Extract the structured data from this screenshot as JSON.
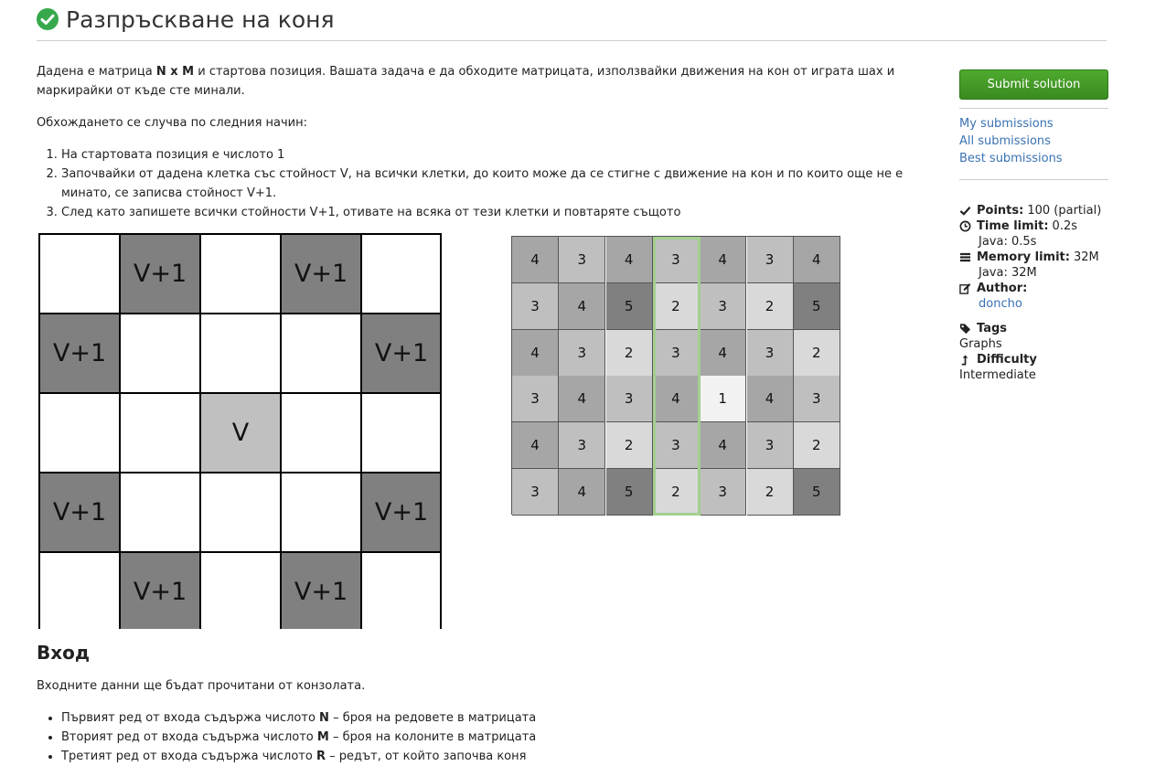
{
  "header": {
    "title": "Разпръскване на коня"
  },
  "statement": {
    "intro_1": "Дадена е матрица ",
    "intro_bold": "N x M",
    "intro_2": " и стартова позиция. Вашата задача е да обходите матрицата, използвайки движения на кон от играта шах и маркирайки от къде сте минали.",
    "process_intro": "Обхождането се случва по следния начин:",
    "steps": [
      "На стартовата позиция е числото 1",
      "Започвайки от дадена клетка със стойност V, на всички клетки, до които може да се стигне с движение на кон и по които още не е минато, се записва стойност V+1.",
      "След като запишете всички стойности V+1, отивате на всяка от тези клетки и повтаряте същото"
    ]
  },
  "illustration_left": {
    "rows": [
      [
        "",
        "V+1",
        "",
        "V+1",
        ""
      ],
      [
        "V+1",
        "",
        "",
        "",
        "V+1"
      ],
      [
        "",
        "",
        "V",
        "",
        ""
      ],
      [
        "V+1",
        "",
        "",
        "",
        "V+1"
      ],
      [
        "",
        "V+1",
        "",
        "V+1",
        ""
      ]
    ],
    "colors": {
      "target": "#808080",
      "source": "#c0c0c0",
      "empty": "#ffffff"
    }
  },
  "illustration_right": {
    "rows": [
      [
        "4",
        "3",
        "4",
        "3",
        "4",
        "3",
        "4"
      ],
      [
        "3",
        "4",
        "5",
        "2",
        "3",
        "2",
        "5"
      ],
      [
        "4",
        "3",
        "2",
        "3",
        "4",
        "3",
        "2"
      ],
      [
        "3",
        "4",
        "3",
        "4",
        "1",
        "4",
        "3"
      ],
      [
        "4",
        "3",
        "2",
        "3",
        "4",
        "3",
        "2"
      ],
      [
        "3",
        "4",
        "5",
        "2",
        "3",
        "2",
        "5"
      ]
    ],
    "shade_by_value": {
      "1": "#f2f2f2",
      "2": "#d9d9d9",
      "3": "#bfbfbf",
      "4": "#a6a6a6",
      "5": "#808080"
    },
    "highlight_color": "#a3cf8f"
  },
  "input_section": {
    "heading": "Вход",
    "intro": "Входните данни ще бъдат прочитани от конзолата.",
    "items": [
      {
        "pre": "Първият ред от входа съдържа числото ",
        "bold": "N",
        "post": " – броя на редовете в матрицата"
      },
      {
        "pre": "Вторият ред от входа съдържа числото ",
        "bold": "M",
        "post": " – броя на колоните в матрицата"
      },
      {
        "pre": "Третият ред от входа съдържа числото ",
        "bold": "R",
        "post": " – редът, от който започва коня"
      }
    ]
  },
  "sidebar": {
    "submit_label": "Submit solution",
    "links": [
      "My submissions",
      "All submissions",
      "Best submissions"
    ],
    "points_label": "Points:",
    "points_value": "100 (partial)",
    "time_label": "Time limit:",
    "time_value": "0.2s",
    "time_java": "Java: 0.5s",
    "memory_label": "Memory limit:",
    "memory_value": "32M",
    "memory_java": "Java: 32M",
    "author_label": "Author:",
    "author_value": "doncho",
    "tags_label": "Tags",
    "tags_value": "Graphs",
    "difficulty_label": "Difficulty",
    "difficulty_value": "Intermediate"
  },
  "colors": {
    "accent_green": "#4eaa2e",
    "link_blue": "#3972b3",
    "check_green": "#38a84c"
  }
}
